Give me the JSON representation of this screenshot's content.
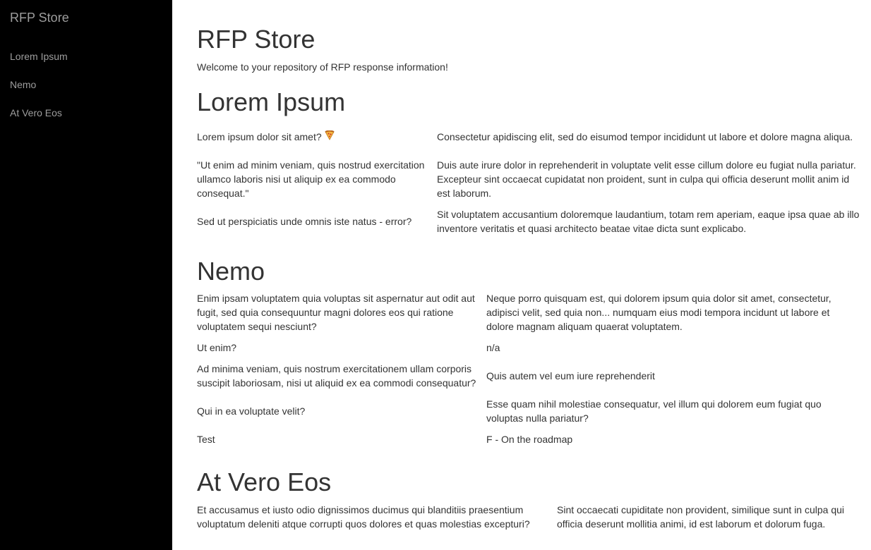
{
  "sidebar": {
    "brand": "RFP Store",
    "items": [
      {
        "label": "Lorem Ipsum"
      },
      {
        "label": "Nemo"
      },
      {
        "label": "At Vero Eos"
      }
    ]
  },
  "main": {
    "title": "RFP Store",
    "welcome": "Welcome to your repository of RFP response information!",
    "sections": [
      {
        "title": "Lorem Ipsum",
        "rows": [
          {
            "q": "Lorem ipsum dolor sit amet?",
            "a": "Consectetur apidiscing elit, sed do eisumod tempor incididunt ut labore et dolore magna aliqua."
          },
          {
            "q": "\"Ut enim ad minim veniam, quis nostrud exercitation ullamco laboris nisi ut aliquip ex ea commodo consequat.\"",
            "a": "Duis aute irure dolor in reprehenderit in voluptate velit esse cillum dolore eu fugiat nulla pariatur. Excepteur sint occaecat cupidatat non proident, sunt in culpa qui officia deserunt mollit anim id est laborum."
          },
          {
            "q": "Sed ut perspiciatis unde omnis iste natus - error?",
            "a": "Sit voluptatem accusantium doloremque laudantium, totam rem aperiam, eaque ipsa quae ab illo inventore veritatis et quasi architecto beatae vitae dicta sunt explicabo."
          }
        ]
      },
      {
        "title": "Nemo",
        "rows": [
          {
            "q": "Enim ipsam voluptatem quia voluptas sit aspernatur aut odit aut fugit, sed quia consequuntur magni dolores eos qui ratione voluptatem sequi nesciunt?",
            "a": "Neque porro quisquam est, qui dolorem ipsum quia dolor sit amet, consectetur, adipisci velit, sed quia non... numquam eius modi tempora incidunt ut labore et dolore magnam aliquam quaerat voluptatem."
          },
          {
            "q": "Ut enim?",
            "a": "n/a"
          },
          {
            "q": "Ad minima veniam, quis nostrum exercitationem ullam corporis suscipit laboriosam, nisi ut aliquid ex ea commodi consequatur?",
            "a": "Quis autem vel eum iure reprehenderit"
          },
          {
            "q": "Qui in ea voluptate velit?",
            "a": "Esse quam nihil molestiae consequatur, vel illum qui dolorem eum fugiat quo voluptas nulla pariatur?"
          },
          {
            "q": "Test",
            "a": "F - On the roadmap"
          }
        ]
      },
      {
        "title": "At Vero Eos",
        "rows": [
          {
            "q": "Et accusamus et iusto odio dignissimos ducimus qui blanditiis praesentium voluptatum deleniti atque corrupti quos dolores et quas molestias excepturi?",
            "a": "Sint occaecati cupiditate non provident, similique sunt in culpa qui officia deserunt mollitia animi, id est laborum et dolorum fuga."
          }
        ]
      }
    ]
  },
  "icons": {
    "pizza": "pizza-icon"
  }
}
